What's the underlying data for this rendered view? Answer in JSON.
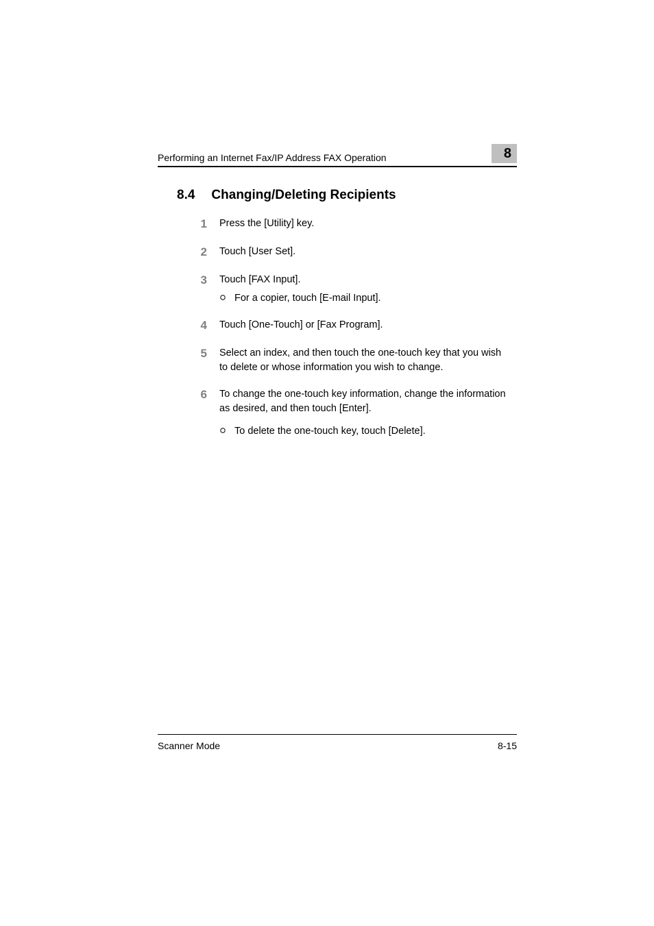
{
  "header": {
    "running_head": "Performing an Internet Fax/IP Address FAX Operation",
    "chapter_badge": "8"
  },
  "section": {
    "number": "8.4",
    "title": "Changing/Deleting Recipients"
  },
  "steps": [
    {
      "num": "1",
      "text": "Press the [Utility] key.",
      "subs": []
    },
    {
      "num": "2",
      "text": "Touch [User Set].",
      "subs": []
    },
    {
      "num": "3",
      "text": "Touch [FAX Input].",
      "subs": [
        "For a copier, touch [E-mail Input]."
      ]
    },
    {
      "num": "4",
      "text": "Touch [One-Touch] or [Fax Program].",
      "subs": []
    },
    {
      "num": "5",
      "text": "Select an index, and then touch the one-touch key that you wish to delete or whose information you wish to change.",
      "subs": []
    },
    {
      "num": "6",
      "text": "To change the one-touch key information, change the information as desired, and then touch [Enter].",
      "subs": [
        "To delete the one-touch key, touch [Delete]."
      ]
    }
  ],
  "footer": {
    "doc_title": "Scanner Mode",
    "page_number": "8-15"
  }
}
